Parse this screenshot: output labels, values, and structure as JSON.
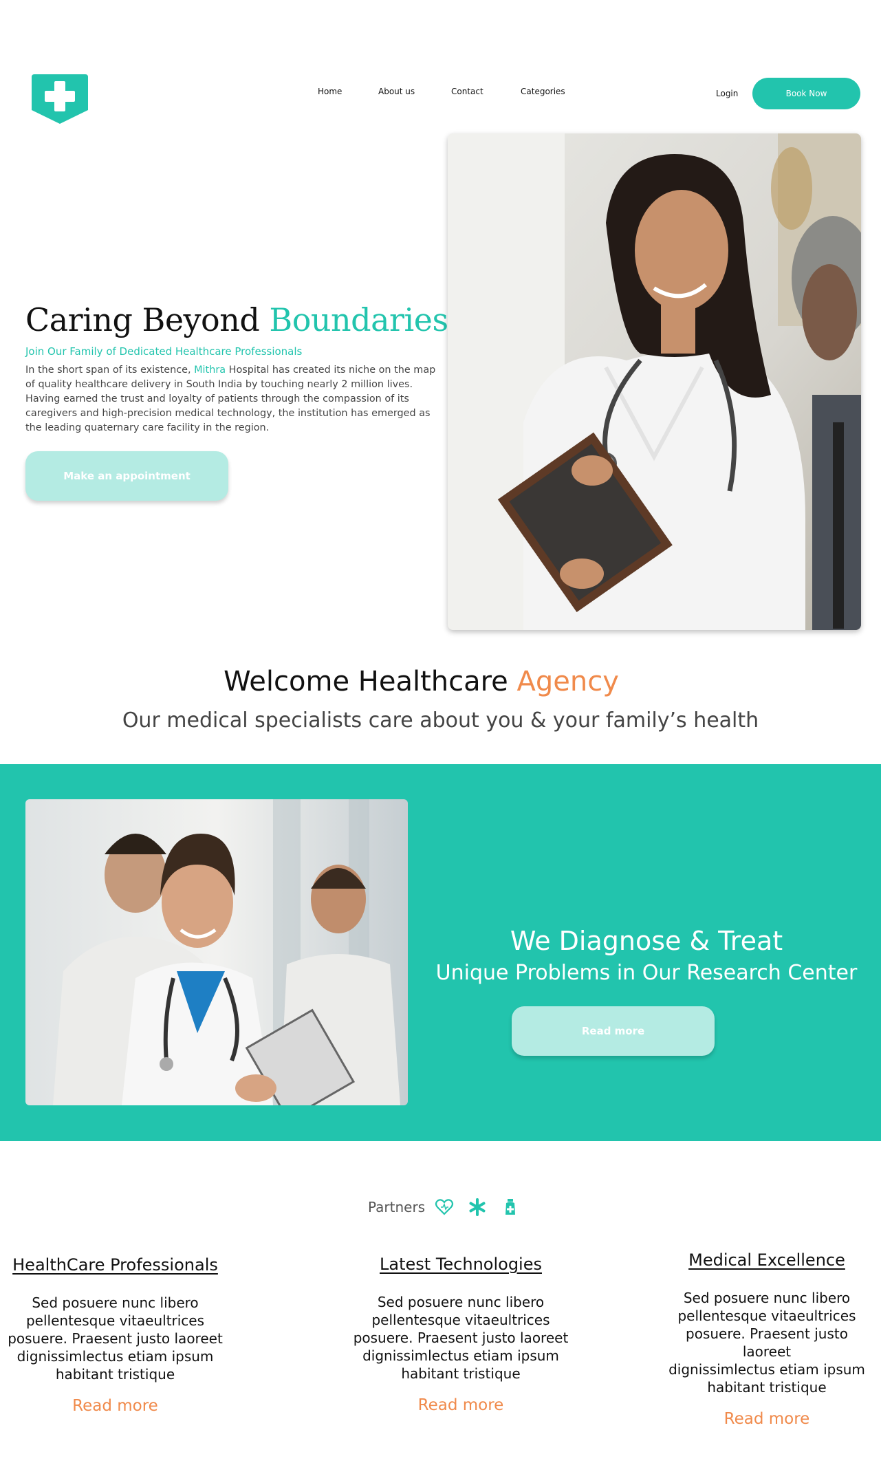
{
  "nav": {
    "links": [
      "Home",
      "About us",
      "Contact",
      "Categories"
    ],
    "login": "Login",
    "book_now": "Book Now"
  },
  "hero": {
    "title_main": "Caring Beyond",
    "title_accent": "Boundaries",
    "subtitle": "Join Our Family of Dedicated Healthcare Professionals",
    "body_pre": "In the short span of its existence,",
    "body_brand": "Mithra",
    "body_post": "Hospital has created its niche on the map of quality healthcare delivery in South India by touching nearly 2 million lives. Having earned the trust and loyalty of patients through the compassion of its caregivers and high-precision medical technology, the institution has emerged as the leading quaternary care facility in the region.",
    "cta": "Make an appointment"
  },
  "welcome": {
    "title_main": "Welcome Healthcare",
    "title_accent": "Agency",
    "subtitle": "Our medical specialists care about you & your family’s health"
  },
  "band": {
    "title": "We Diagnose & Treat",
    "subtitle": "Unique Problems in Our Research Center",
    "cta": "Read more"
  },
  "partners": {
    "label": "Partners",
    "icons": [
      "heart-icon",
      "asterisk-icon",
      "medicine-bottle-icon"
    ]
  },
  "features": [
    {
      "title": "HealthCare Professionals",
      "lines": [
        "Sed posuere nunc libero",
        "pellentesque vitaeultrices",
        "posuere. Praesent justo laoreet",
        "dignissimlectus etiam ipsum",
        "habitant tristique"
      ],
      "more": "Read more"
    },
    {
      "title": "Latest Technologies",
      "lines": [
        "Sed posuere nunc libero",
        "pellentesque vitaeultrices",
        "posuere. Praesent justo laoreet",
        "dignissimlectus etiam ipsum",
        "habitant tristique"
      ],
      "more": "Read more"
    },
    {
      "title": "Medical Excellence",
      "lines": [
        "Sed posuere nunc libero",
        "pellentesque vitaeultrices",
        "posuere. Praesent justo laoreet",
        "dignissimlectus etiam ipsum",
        "habitant tristique"
      ],
      "more": "Read more"
    }
  ],
  "colors": {
    "accent": "#22c4ad",
    "accent_light": "#b4ebe3",
    "orange": "#f08a4b"
  }
}
